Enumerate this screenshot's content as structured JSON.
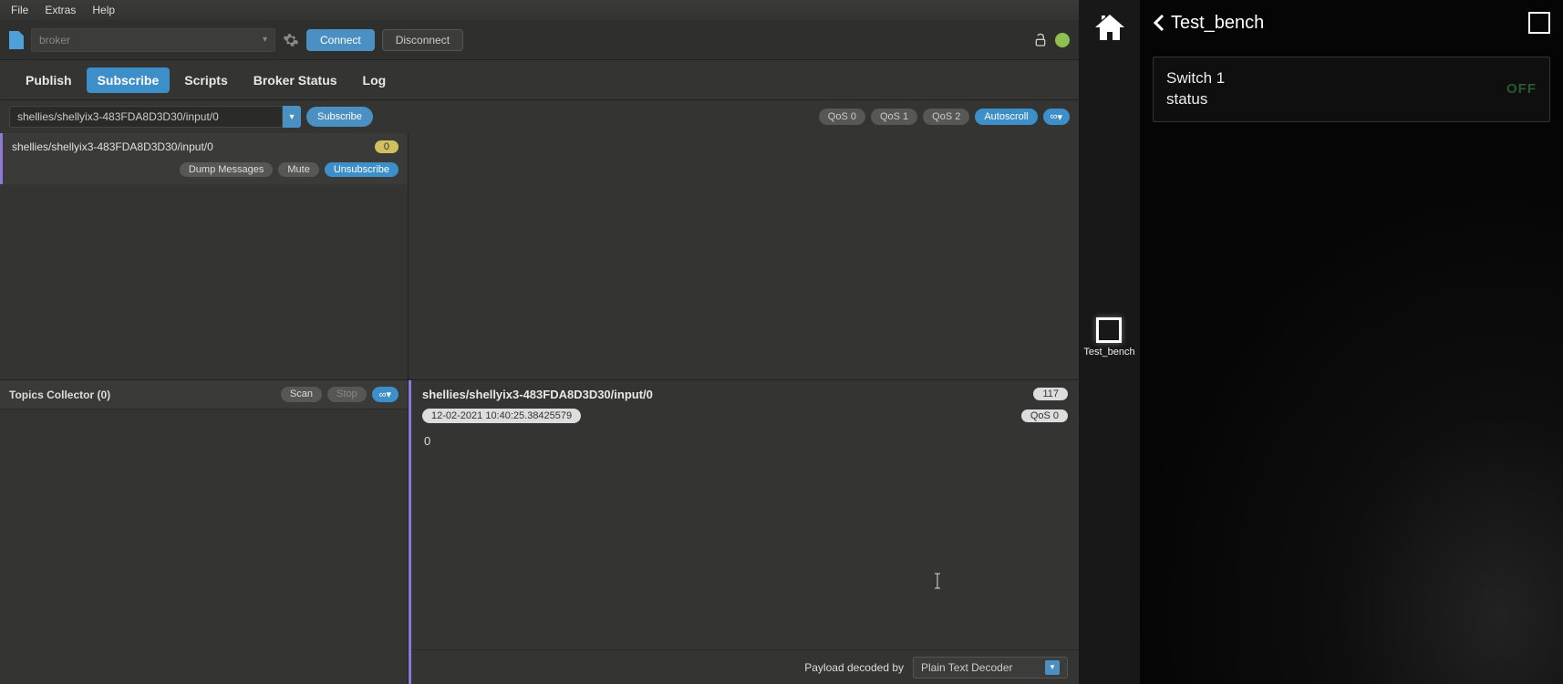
{
  "menu": {
    "file": "File",
    "extras": "Extras",
    "help": "Help"
  },
  "toolbar": {
    "broker_placeholder": "broker",
    "connect": "Connect",
    "disconnect": "Disconnect"
  },
  "tabs": {
    "publish": "Publish",
    "subscribe": "Subscribe",
    "scripts": "Scripts",
    "broker_status": "Broker Status",
    "log": "Log"
  },
  "subscribe_bar": {
    "topic_value": "shellies/shellyix3-483FDA8D3D30/input/0",
    "subscribe": "Subscribe",
    "qos0": "QoS 0",
    "qos1": "QoS 1",
    "qos2": "QoS 2",
    "autoscroll": "Autoscroll",
    "link_icon": "∞"
  },
  "subscription_card": {
    "topic": "shellies/shellyix3-483FDA8D3D30/input/0",
    "count": "0",
    "dump": "Dump Messages",
    "mute": "Mute",
    "unsubscribe": "Unsubscribe"
  },
  "topics_collector": {
    "title": "Topics Collector (0)",
    "scan": "Scan",
    "stop": "Stop",
    "link_icon": "∞"
  },
  "message_detail": {
    "topic": "shellies/shellyix3-483FDA8D3D30/input/0",
    "count": "117",
    "timestamp": "12-02-2021  10:40:25.38425579",
    "qos": "QoS 0",
    "payload": "0",
    "decoder_label": "Payload decoded by",
    "decoder_value": "Plain Text Decoder"
  },
  "right_panel": {
    "title": "Test_bench",
    "nav_label": "Test_bench",
    "card_line1": "Switch 1",
    "card_line2": "status",
    "card_state": "OFF"
  }
}
